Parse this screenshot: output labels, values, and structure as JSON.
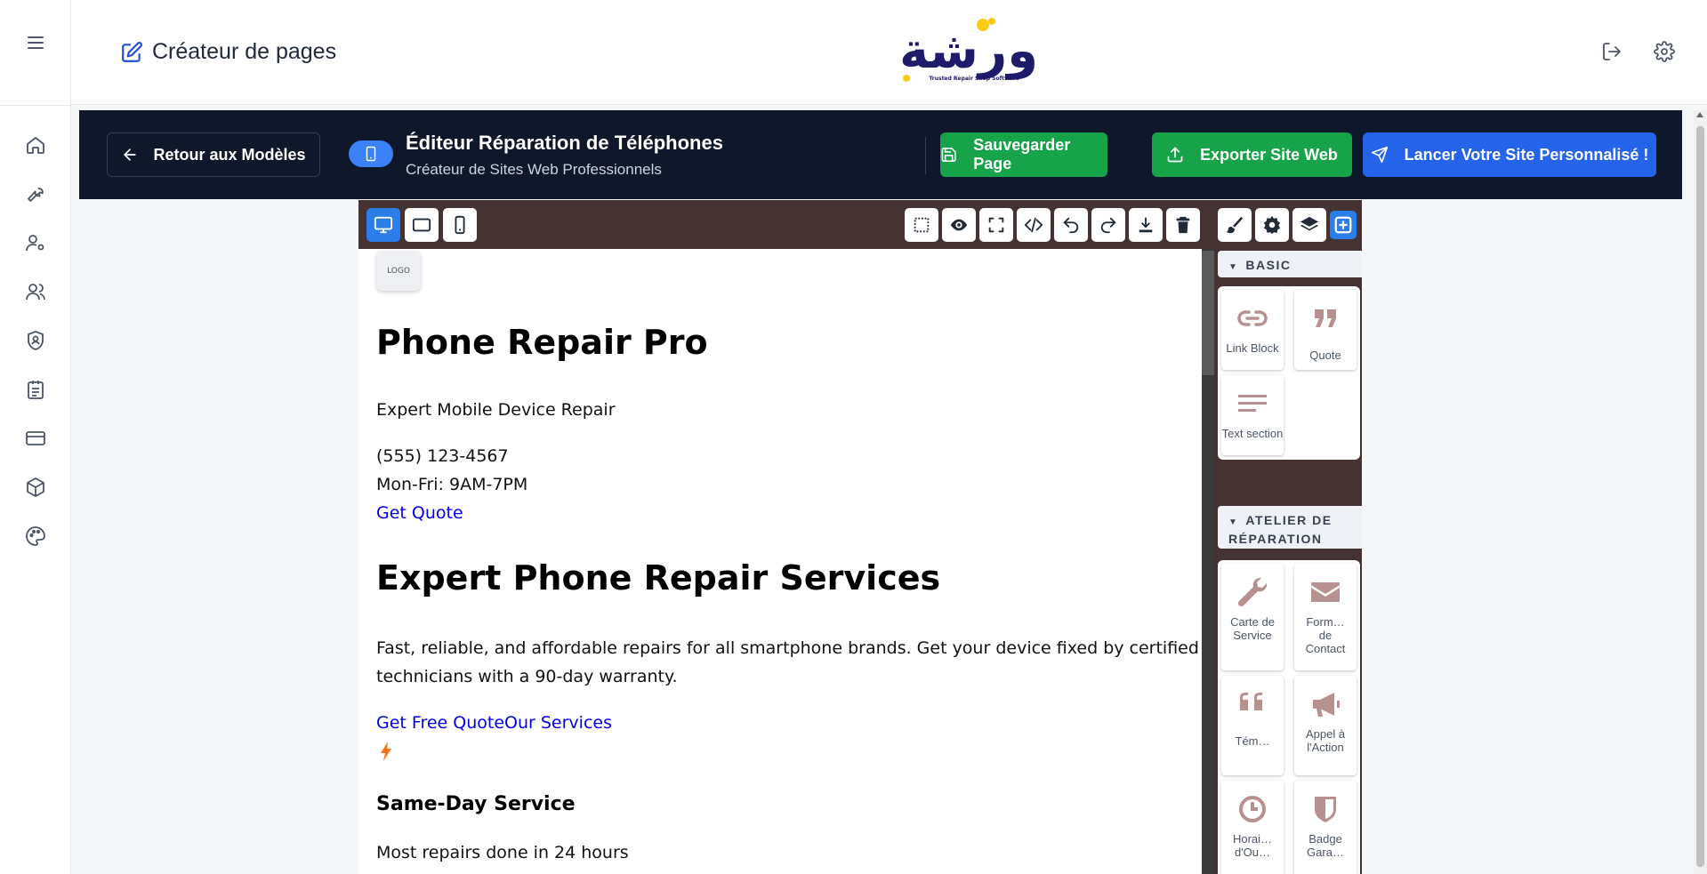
{
  "header": {
    "title": "Créateur de pages",
    "logo_alt": "ورشة",
    "logo_tagline": "Trusted Repair Shop Software"
  },
  "editor": {
    "back_label": "Retour aux Modèles",
    "title": "Éditeur Réparation de Téléphones",
    "subtitle": "Créateur de Sites Web Professionnels",
    "save_label": "Sauvegarder Page",
    "export_label": "Exporter Site Web",
    "launch_label": "Lancer Votre Site Personnalisé !"
  },
  "page_content": {
    "logo": "LOGO",
    "site_title": "Phone Repair Pro",
    "tagline": "Expert Mobile Device Repair",
    "phone": "(555) 123-4567",
    "hours": "Mon-Fri: 9AM-7PM",
    "get_quote": "Get Quote",
    "hero_title": "Expert Phone Repair Services",
    "hero_text_1": "Fast, reliable, and affordable repairs for all smartphone brands. Get your device fixed by certified",
    "hero_text_2": "technicians with a 90-day warranty.",
    "cta_links": "Get Free QuoteOur Services",
    "feature_title": "Same-Day Service",
    "feature_text": "Most repairs done in 24 hours"
  },
  "blocks": {
    "basic_label": "BASIC",
    "basic": [
      {
        "label": "Link Block",
        "icon": "link-icon"
      },
      {
        "label": "Quote",
        "icon": "quote-icon"
      },
      {
        "label": "Text section",
        "icon": "text-lines-icon"
      }
    ],
    "repair_label_1": "ATELIER DE",
    "repair_label_2": "RÉPARATION",
    "repair": [
      {
        "label": "Carte de Service",
        "icon": "wrench-icon"
      },
      {
        "label": "Form… de Contact",
        "icon": "envelope-icon"
      },
      {
        "label": "Tém…",
        "icon": "quote-icon"
      },
      {
        "label": "Appel à l'Action",
        "icon": "megaphone-icon"
      },
      {
        "label": "Horai… d'Ou…",
        "icon": "clock-icon"
      },
      {
        "label": "Badge Gara…",
        "icon": "shield-icon"
      }
    ]
  },
  "colors": {
    "editor_header": "#0f172a",
    "save_green": "#16a34a",
    "launch_blue": "#2563eb",
    "toolbar_brown": "#443332",
    "active_blue": "#2b7de9"
  }
}
